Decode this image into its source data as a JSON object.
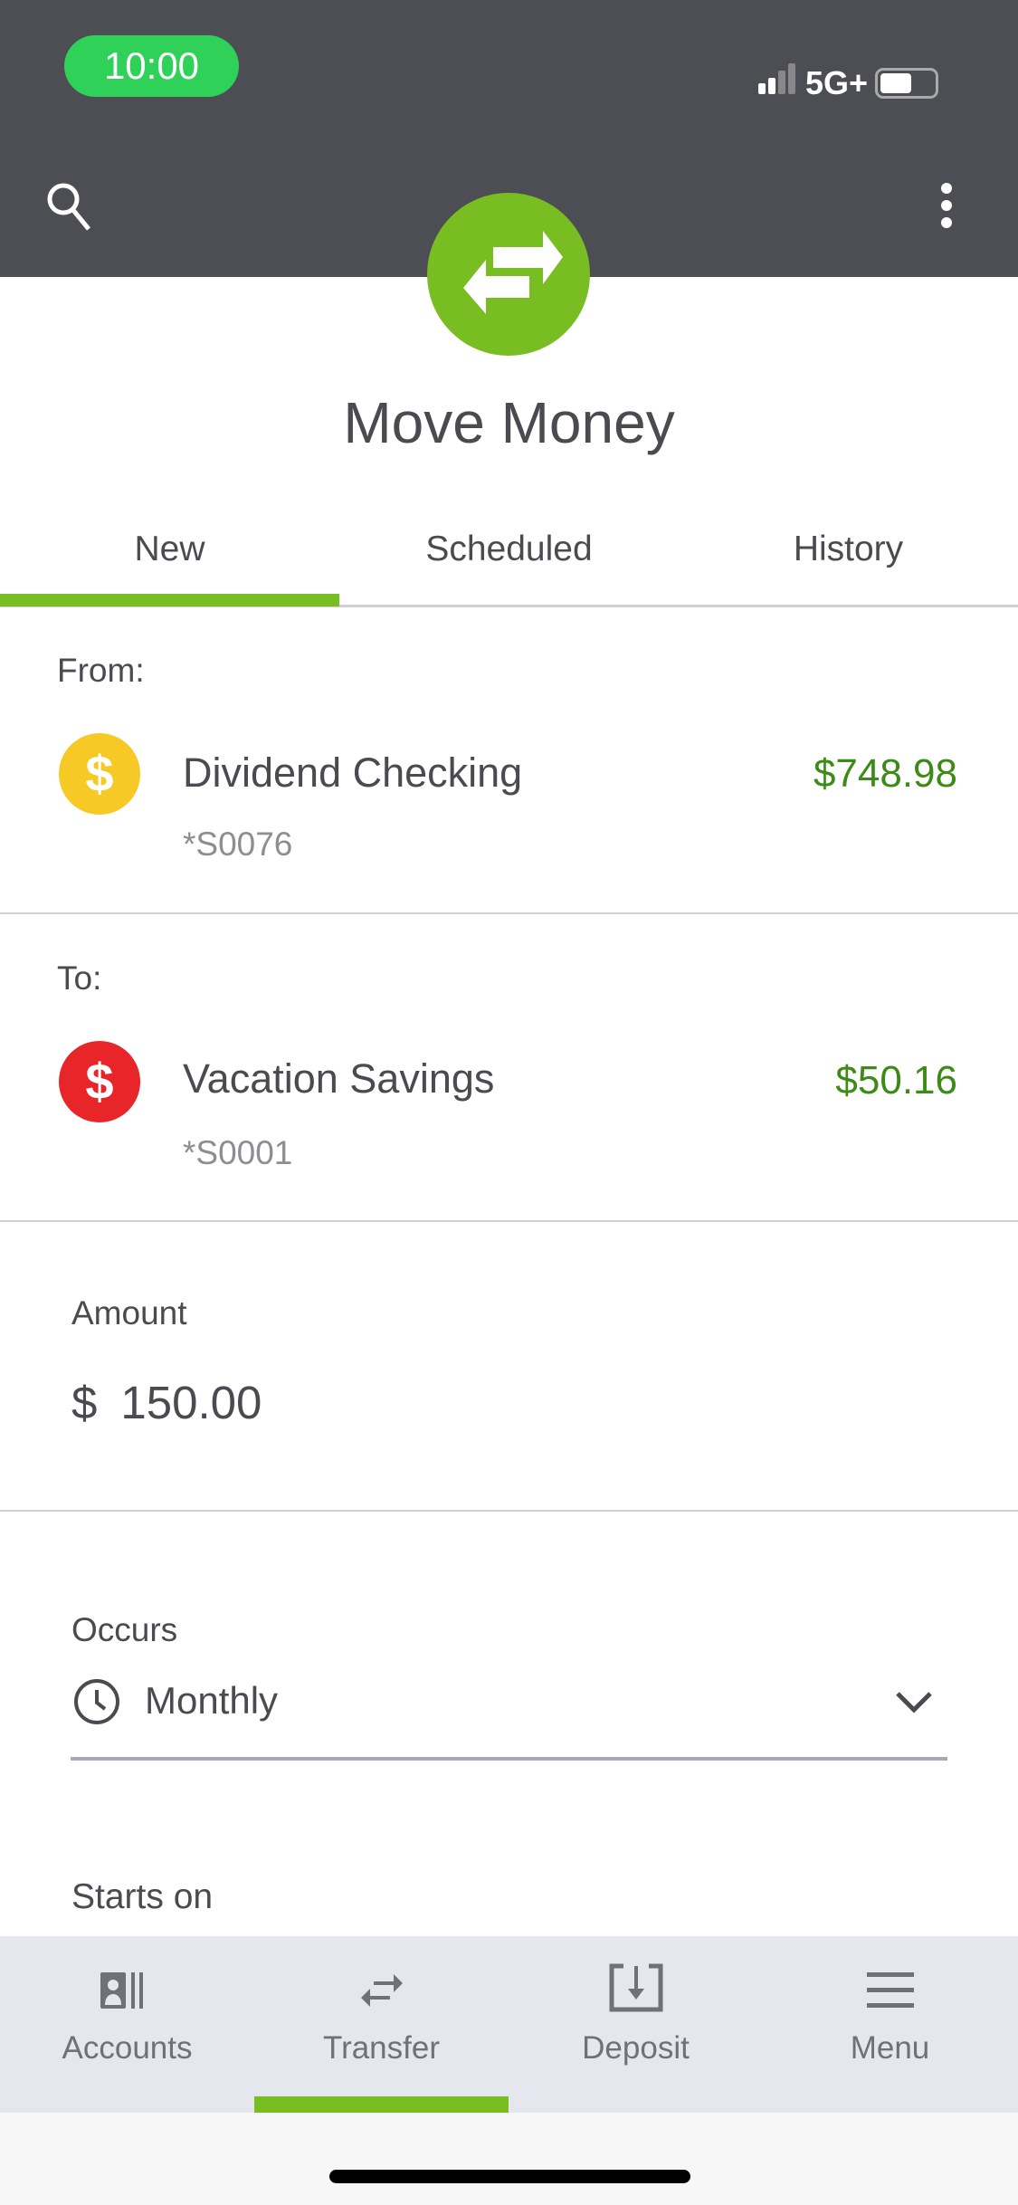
{
  "status_bar": {
    "time": "10:00",
    "network": "5G+"
  },
  "header": {
    "title": "Move Money",
    "icon": "transfer-arrows-icon"
  },
  "tabs": [
    {
      "label": "New",
      "active": true
    },
    {
      "label": "Scheduled"
    },
    {
      "label": "History"
    }
  ],
  "from": {
    "label": "From:",
    "account": "Dividend Checking",
    "number": "*S0076",
    "balance": "$748.98",
    "icon_color": "#f7c925"
  },
  "to": {
    "label": "To:",
    "account": "Vacation Savings",
    "number": "*S0001",
    "balance": "$50.16",
    "icon_color": "#e8262a"
  },
  "amount": {
    "label": "Amount",
    "currency": "$",
    "value": "150.00"
  },
  "occurs": {
    "label": "Occurs",
    "value": "Monthly"
  },
  "starts_on": {
    "label": "Starts on"
  },
  "bottom_nav": [
    {
      "label": "Accounts"
    },
    {
      "label": "Transfer",
      "active": true
    },
    {
      "label": "Deposit"
    },
    {
      "label": "Menu"
    }
  ],
  "colors": {
    "accent": "#78bd22",
    "header": "#4d4e53",
    "balance": "#3d8b16"
  }
}
